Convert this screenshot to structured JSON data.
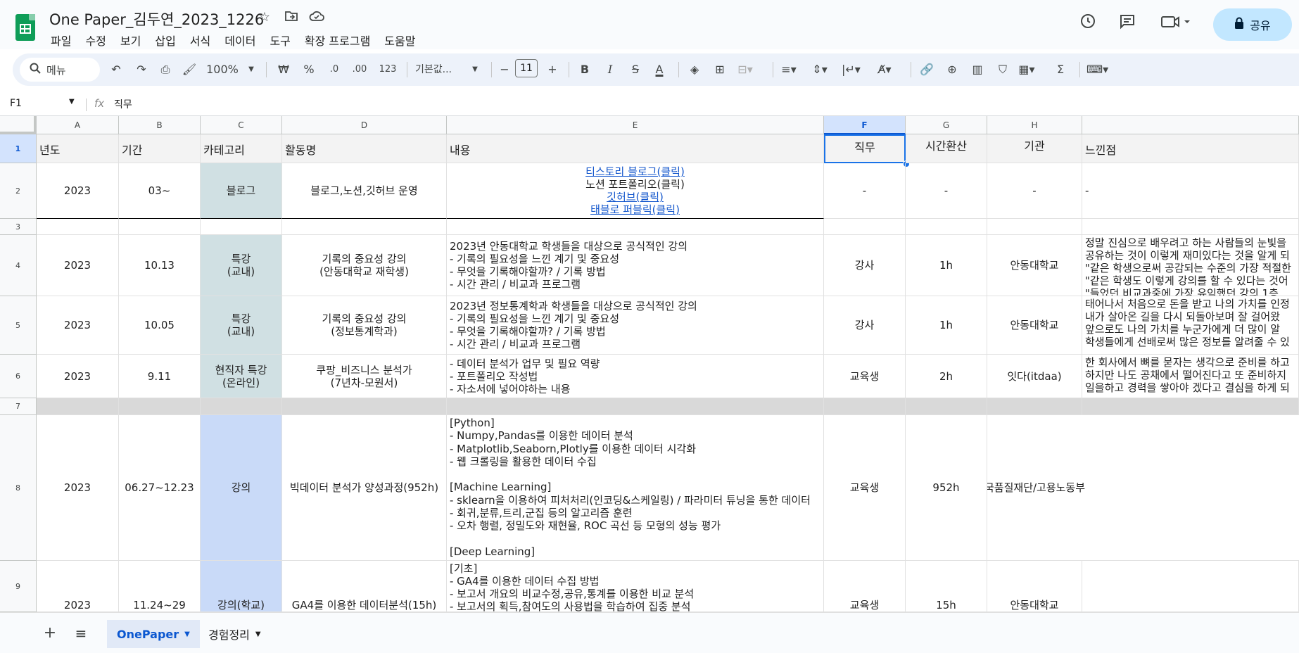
{
  "app": {
    "title": "One Paper_김두연_2023_1226"
  },
  "menu": [
    "파일",
    "수정",
    "보기",
    "삽입",
    "서식",
    "데이터",
    "도구",
    "확장 프로그램",
    "도움말"
  ],
  "share": {
    "label": "공유"
  },
  "toolbar": {
    "search_placeholder": "메뉴",
    "zoom": "100%",
    "currency": "₩",
    "percent": "%",
    "dec_minus": ".0",
    "dec_plus": ".00",
    "number_format": "123",
    "font": "기본값...",
    "font_size": "11"
  },
  "formula": {
    "cell_ref": "F1",
    "fx": "fx",
    "value": "직무"
  },
  "columns": [
    "A",
    "B",
    "C",
    "D",
    "E",
    "F",
    "G",
    "H"
  ],
  "rows": [
    "1",
    "2",
    "3",
    "4",
    "5",
    "6",
    "7",
    "8",
    "9"
  ],
  "header": {
    "a": "년도",
    "b": "기간",
    "c": "카테고리",
    "d": "활동명",
    "e": "내용",
    "f": "직무",
    "g": "시간환산",
    "h": "기관",
    "i": "느낀점"
  },
  "r2": {
    "a": "2023",
    "b": "03~",
    "c": "블로그",
    "d": "블로그,노션,깃허브 운영",
    "e": [
      "티스토리 블로그(클릭)",
      "노션 포트폴리오(클릭)",
      "깃허브(클릭)",
      "태블로 퍼블릭(클릭)"
    ],
    "f": "-",
    "g": "-",
    "h": "-",
    "i": "-"
  },
  "r4": {
    "a": "2023",
    "b": "10.13",
    "c": "특강\n(교내)",
    "d": "기록의 중요성 강의\n(안동대학교 재학생)",
    "e": "2023년 안동대학교 학생들을 대상으로 공식적인 강의\n- 기록의 필요성을 느낀 계기 및 중요성\n- 무엇을 기록해야할까? / 기록 방법\n- 시간 관리 / 비교과 프로그램",
    "f": "강사",
    "g": "1h",
    "h": "안동대학교",
    "i": "정말 진심으로 배우려고 하는 사람들의 눈빛을\n공유하는 것이 이렇게 재미있다는 것을 알게 되\n\"같은 학생으로써 공감되는 수준의 가장 적절한\n\"같은 학생도 이렇게 강의를 할 수 있다는 것어\n\"들었던 비교과중에 가장 유익했던 강의 1층"
  },
  "r5": {
    "a": "2023",
    "b": "10.05",
    "c": "특강\n(교내)",
    "d": "기록의 중요성 강의\n(정보통계학과)",
    "e": "2023년 정보통계학과 학생들을 대상으로 공식적인 강의\n- 기록의 필요성을 느낀 계기 및 중요성\n- 무엇을 기록해야할까? / 기록 방법\n- 시간 관리 / 비교과 프로그램",
    "f": "강사",
    "g": "1h",
    "h": "안동대학교",
    "i": "태어나서 처음으로 돈을 받고 나의 가치를 인정\n내가 살아온 길을 다시 되돌아보며 잘 걸어왔\n앞으로도 나의 가치를 누군가에게 더 많이 알\n학생들에게 선배로써 많은 정보를 알려줄 수 있"
  },
  "r6": {
    "a": "2023",
    "b": "9.11",
    "c": "현직자 특강\n(온라인)",
    "d": "쿠팡_비즈니스 분석가\n(7년차-모원서)",
    "e": "- 데이터 분석가 업무 및 필요 역량\n- 포트폴리오 작성법\n- 자소서에 넣어야하는 내용",
    "f": "교육생",
    "g": "2h",
    "h": "잇다(itdaa)",
    "i": "한 회사에서 뼈를 묻자는 생각으로 준비를 하고\n하지만 나도 공채에서 떨어진다고 또 준비하지\n일을하고 경력을 쌓아야 겠다고 결심을 하게 되"
  },
  "r8": {
    "a": "2023",
    "b": "06.27~12.23",
    "c": "강의",
    "d": "빅데이터 분석가 양성과정(952h)",
    "e": "[Python]\n- Numpy,Pandas를 이용한 데이터 분석\n- Matplotlib,Seaborn,Plotly를 이용한 데이터 시각화\n- 웹 크롤링을 활용한 데이터 수집\n\n[Machine Learning]\n- sklearn을 이용하여 피처처리(인코딩&스케일링) / 파라미터 튜닝을 통한 데이터\n- 회귀,분류,트리,군집 등의 알고리즘 훈련\n- 오차 행렬, 정밀도와 재현율, ROC 곡선 등 모형의 성능 평가\n\n[Deep Learning]",
    "f": "교육생",
    "g": "952h",
    "h": "국품질재단/고용노동부"
  },
  "r9": {
    "a": "2023",
    "b": "11.24~29",
    "c": "강의(학교)",
    "d": "GA4를 이용한 데이터분석(15h)",
    "e": "[기초]\n- GA4를 이용한 데이터 수집 방법\n- 보고서 개요의 비교수정,공유,통계를 이용한 비교 분석\n- 보고서의 획득,참여도의 사용법을 학습하여 집중 분석",
    "f": "교육생",
    "g": "15h",
    "h": "안동대학교"
  },
  "tabs": {
    "sheet1": "OnePaper",
    "sheet2": "경험정리"
  }
}
